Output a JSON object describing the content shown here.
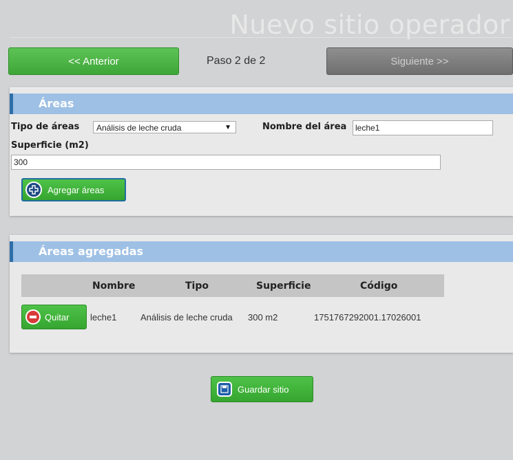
{
  "header": {
    "title": "Nuevo sitio operador"
  },
  "nav": {
    "prev_label": "<< Anterior",
    "step_label": "Paso 2 de 2",
    "next_label": "Siguiente >>"
  },
  "areas_panel": {
    "title": "Áreas",
    "tipo_label": "Tipo de áreas",
    "tipo_selected": "Análisis de leche cruda",
    "nombre_label": "Nombre del área",
    "nombre_value": "leche1",
    "superficie_label": "Superficie (m2)",
    "superficie_value": "300",
    "add_button_label": "Agregar áreas"
  },
  "added_panel": {
    "title": "Áreas agregadas",
    "columns": [
      "Nombre",
      "Tipo",
      "Superficie",
      "Código"
    ],
    "rows": [
      {
        "remove_label": "Quitar",
        "nombre": "leche1",
        "tipo": "Análisis de leche cruda",
        "superficie": "300 m2",
        "codigo": "1751767292001.17026001"
      }
    ]
  },
  "save_button_label": "Guardar sitio",
  "icons": {
    "add": "plus-circle-icon",
    "remove": "minus-circle-icon",
    "save": "floppy-disk-icon"
  },
  "colors": {
    "green": "#3ea638",
    "header_blue": "#9ec0e4",
    "gray_button": "#7a7a7a"
  }
}
